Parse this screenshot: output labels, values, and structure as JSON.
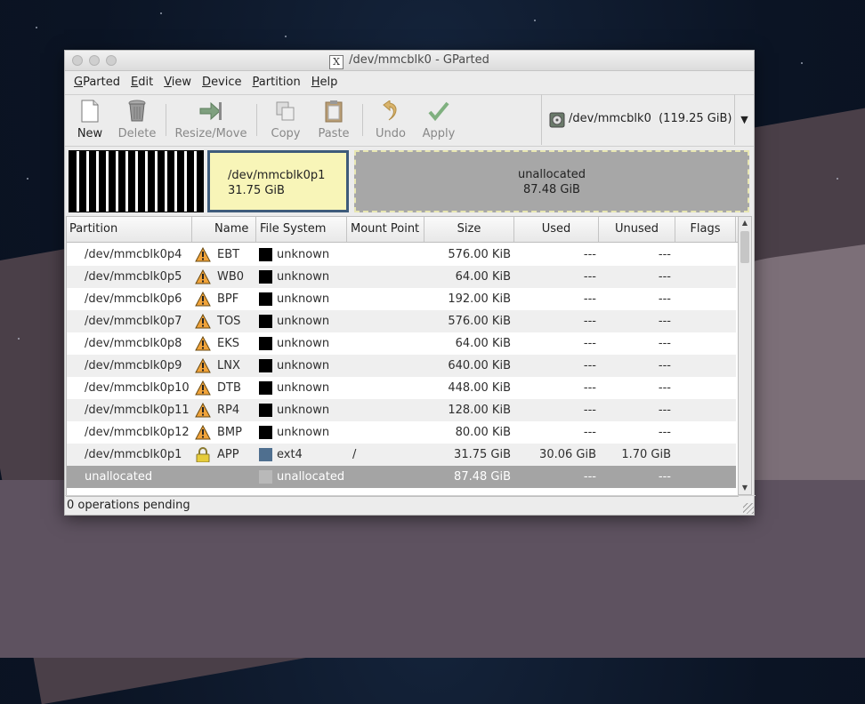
{
  "window": {
    "title": "/dev/mmcblk0 - GParted"
  },
  "menu": [
    {
      "u": "G",
      "rest": "Parted"
    },
    {
      "u": "E",
      "rest": "dit"
    },
    {
      "u": "V",
      "rest": "iew"
    },
    {
      "u": "D",
      "rest": "evice"
    },
    {
      "u": "P",
      "rest": "artition"
    },
    {
      "u": "H",
      "rest": "elp"
    }
  ],
  "toolbar": {
    "new": "New",
    "delete": "Delete",
    "resize": "Resize/Move",
    "copy": "Copy",
    "paste": "Paste",
    "undo": "Undo",
    "apply": "Apply",
    "device": "/dev/mmcblk0  (119.25 GiB)"
  },
  "diskmap": {
    "p1_name": "/dev/mmcblk0p1",
    "p1_size": "31.75 GiB",
    "un_name": "unallocated",
    "un_size": "87.48 GiB"
  },
  "table": {
    "headers": [
      "Partition",
      "Name",
      "File System",
      "Mount Point",
      "Size",
      "Used",
      "Unused",
      "Flags"
    ],
    "rows": [
      {
        "partition": "/dev/mmcblk0p4",
        "name": "EBT",
        "fs": "unknown",
        "mount": "",
        "size": "576.00 KiB",
        "used": "---",
        "unused": "---",
        "icon": "warning",
        "color": "#000000"
      },
      {
        "partition": "/dev/mmcblk0p5",
        "name": "WB0",
        "fs": "unknown",
        "mount": "",
        "size": "64.00 KiB",
        "used": "---",
        "unused": "---",
        "icon": "warning",
        "color": "#000000"
      },
      {
        "partition": "/dev/mmcblk0p6",
        "name": "BPF",
        "fs": "unknown",
        "mount": "",
        "size": "192.00 KiB",
        "used": "---",
        "unused": "---",
        "icon": "warning",
        "color": "#000000"
      },
      {
        "partition": "/dev/mmcblk0p7",
        "name": "TOS",
        "fs": "unknown",
        "mount": "",
        "size": "576.00 KiB",
        "used": "---",
        "unused": "---",
        "icon": "warning",
        "color": "#000000"
      },
      {
        "partition": "/dev/mmcblk0p8",
        "name": "EKS",
        "fs": "unknown",
        "mount": "",
        "size": "64.00 KiB",
        "used": "---",
        "unused": "---",
        "icon": "warning",
        "color": "#000000"
      },
      {
        "partition": "/dev/mmcblk0p9",
        "name": "LNX",
        "fs": "unknown",
        "mount": "",
        "size": "640.00 KiB",
        "used": "---",
        "unused": "---",
        "icon": "warning",
        "color": "#000000"
      },
      {
        "partition": "/dev/mmcblk0p10",
        "name": "DTB",
        "fs": "unknown",
        "mount": "",
        "size": "448.00 KiB",
        "used": "---",
        "unused": "---",
        "icon": "warning",
        "color": "#000000"
      },
      {
        "partition": "/dev/mmcblk0p11",
        "name": "RP4",
        "fs": "unknown",
        "mount": "",
        "size": "128.00 KiB",
        "used": "---",
        "unused": "---",
        "icon": "warning",
        "color": "#000000"
      },
      {
        "partition": "/dev/mmcblk0p12",
        "name": "BMP",
        "fs": "unknown",
        "mount": "",
        "size": "80.00 KiB",
        "used": "---",
        "unused": "---",
        "icon": "warning",
        "color": "#000000"
      },
      {
        "partition": "/dev/mmcblk0p1",
        "name": "APP",
        "fs": "ext4",
        "mount": "/",
        "size": "31.75 GiB",
        "used": "30.06 GiB",
        "unused": "1.70 GiB",
        "icon": "lock",
        "color": "#4f6f8f"
      },
      {
        "partition": "unallocated",
        "name": "",
        "fs": "unallocated",
        "mount": "",
        "size": "87.48 GiB",
        "used": "---",
        "unused": "---",
        "icon": "",
        "color": "#b9b9b9",
        "selected": true
      }
    ]
  },
  "status": "0 operations pending"
}
